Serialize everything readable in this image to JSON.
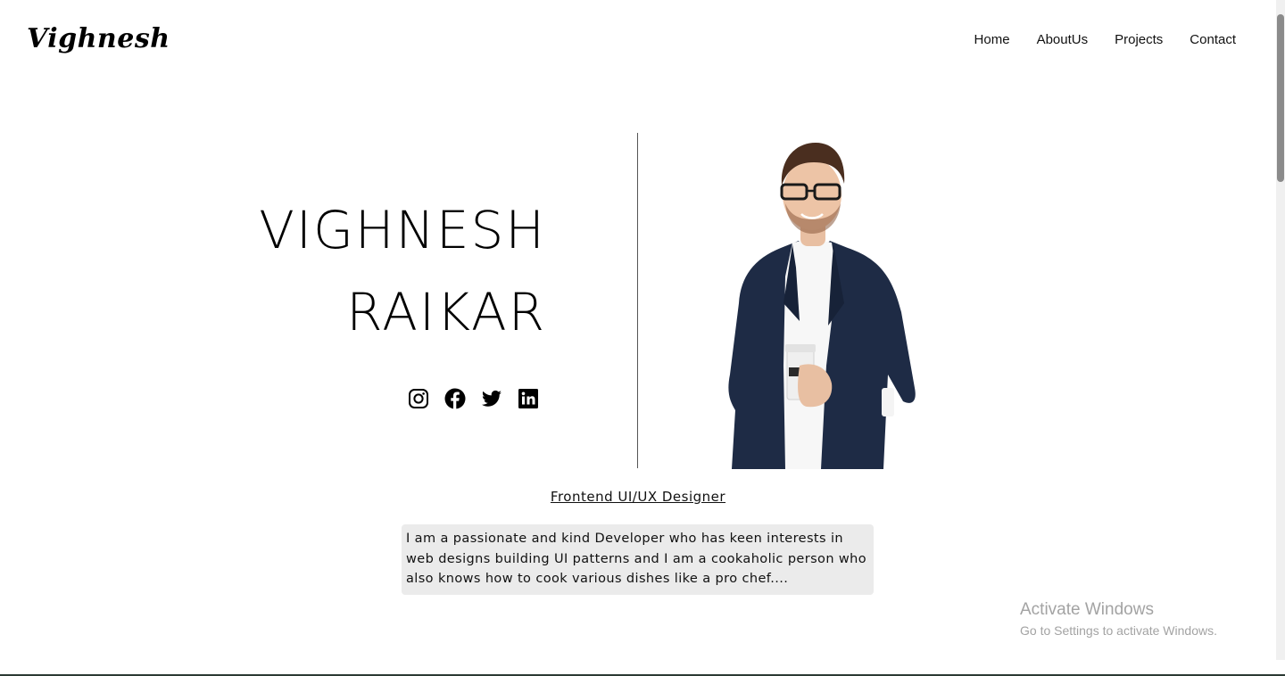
{
  "header": {
    "logo": "Vighnesh",
    "nav": [
      {
        "label": "Home"
      },
      {
        "label": "AboutUs"
      },
      {
        "label": "Projects"
      },
      {
        "label": "Contact"
      }
    ]
  },
  "hero": {
    "first_name": "VIGHNESH",
    "last_name": "RAIKAR",
    "socials": [
      {
        "icon": "instagram-icon"
      },
      {
        "icon": "facebook-icon"
      },
      {
        "icon": "twitter-icon"
      },
      {
        "icon": "linkedin-icon"
      }
    ],
    "portrait": "portrait-photo"
  },
  "tagline": "Frontend UI/UX Designer",
  "bio": "I am a passionate and kind Developer who has keen interests in web designs building UI patterns and I am a cookaholic person who also knows how to cook various dishes like a pro chef....",
  "watermark": {
    "title": "Activate Windows",
    "subtitle": "Go to Settings to activate Windows."
  },
  "colors": {
    "background": "#ffffff",
    "text": "#111111",
    "bio_background": "#ebebeb",
    "divider": "#555555",
    "watermark": "#a3a3a3"
  }
}
